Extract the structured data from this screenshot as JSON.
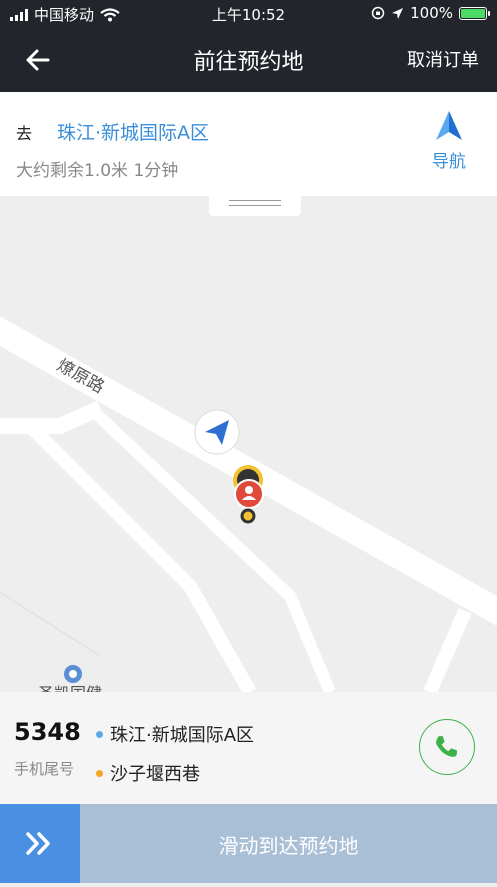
{
  "status_bar": {
    "carrier": "中国移动",
    "time": "上午10:52",
    "battery": "100%"
  },
  "nav": {
    "title": "前往预约地",
    "cancel_label": "取消订单"
  },
  "destination": {
    "prefix": "去",
    "name": "珠江·新城国际A区",
    "remaining": "大约剩余1.0米 1分钟",
    "nav_label": "导航"
  },
  "map": {
    "road_label": "燎原路",
    "poi_label": "圣凯国健"
  },
  "order": {
    "tail_number": "5348",
    "tail_label": "手机尾号",
    "from": "珠江·新城国际A区",
    "to": "沙子堰西巷",
    "from_color": "#5aa9e6",
    "to_color": "#f5a623"
  },
  "slider": {
    "label": "滑动到达预约地"
  },
  "colors": {
    "accent": "#3b8fd9",
    "phone_green": "#3cb24a",
    "bar_dark": "#23252c"
  }
}
